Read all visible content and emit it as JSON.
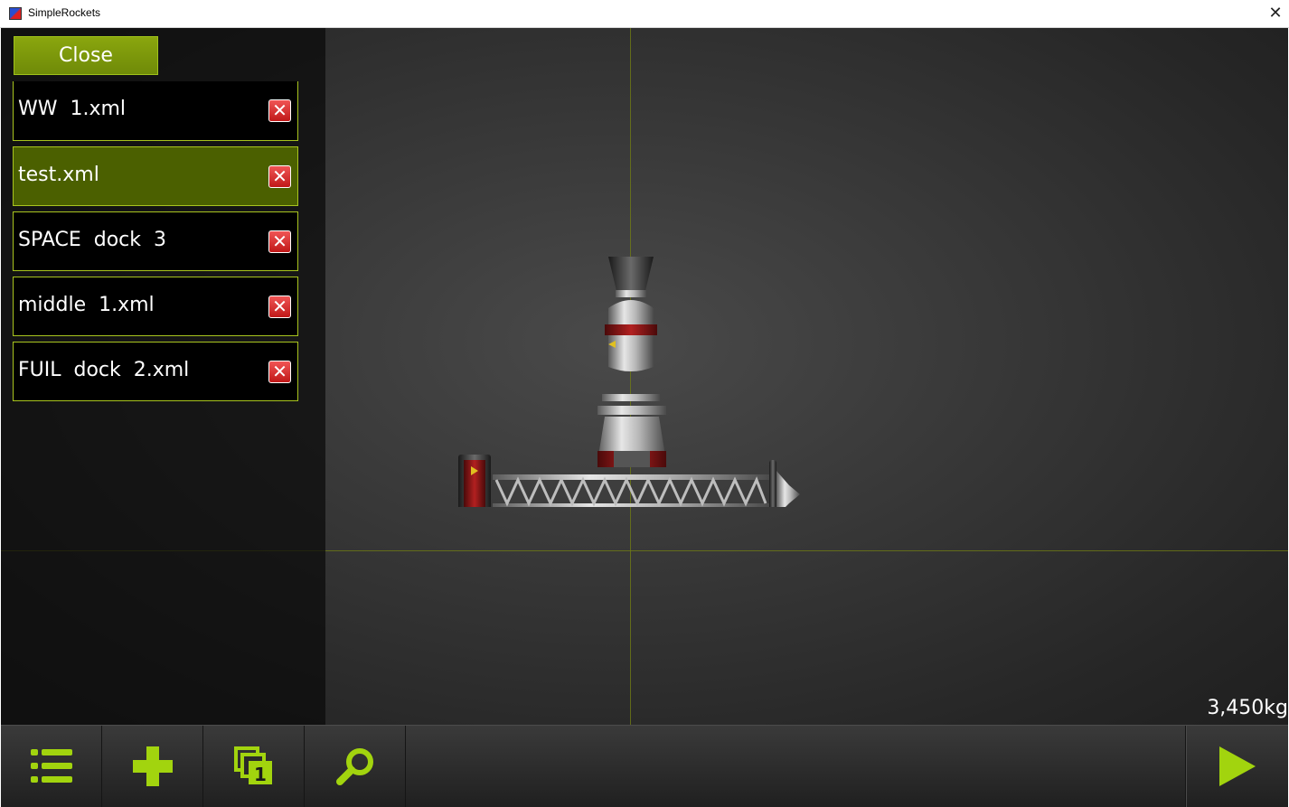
{
  "window": {
    "title": "SimpleRockets",
    "close_glyph": "✕"
  },
  "panel": {
    "close_label": "Close",
    "files": [
      {
        "name": "WW  1.xml",
        "selected": false
      },
      {
        "name": "test.xml",
        "selected": true
      },
      {
        "name": "SPACE  dock  3",
        "selected": false
      },
      {
        "name": "middle  1.xml",
        "selected": false
      },
      {
        "name": "FUIL  dock  2.xml",
        "selected": false
      }
    ],
    "delete_glyph": "✕"
  },
  "status": {
    "mass": "3,450kg"
  },
  "toolbar": {
    "icons": [
      "list-icon",
      "add-part-icon",
      "stages-icon",
      "search-icon",
      "play-icon"
    ],
    "stage_count": "1"
  },
  "colors": {
    "accent": "#a2d40e",
    "selected_row": "#4b6000",
    "grid": "#6f7b14"
  }
}
